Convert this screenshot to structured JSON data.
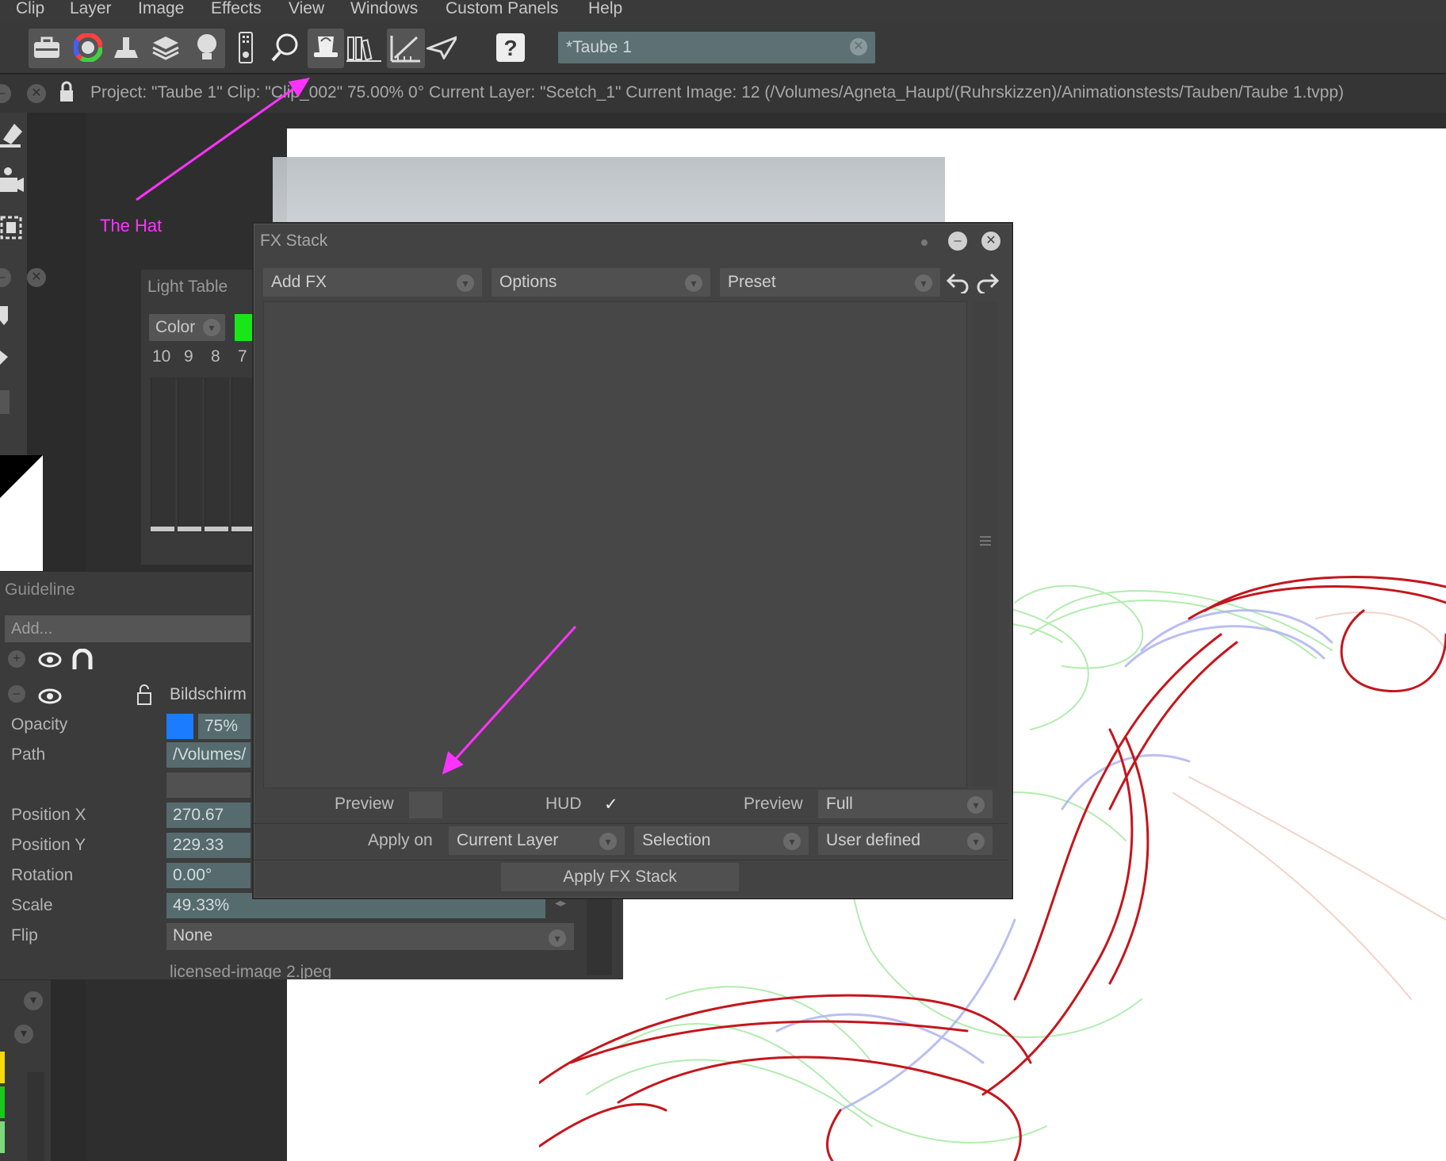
{
  "menu": [
    "Clip",
    "Layer",
    "Image",
    "Effects",
    "View",
    "Windows",
    "Custom Panels",
    "Help"
  ],
  "project_field": {
    "value": "*Taube 1"
  },
  "status": "Project:  \"Taube 1\"  Clip: \"Clip_002\"   75.00%   0°  Current Layer: \"Scetch_1\"  Current Image: 12 (/Volumes/Agneta_Haupt/(Ruhrskizzen)/Animationstests/Tauben/Taube 1.tvpp)",
  "annotation_hat": "The Hat",
  "light_table": {
    "title": "Light Table",
    "color_label": "Color",
    "numbers": [
      "10",
      "9",
      "8",
      "7"
    ]
  },
  "guideline": {
    "title": "Guideline",
    "add_label": "Add...",
    "item_name": "Bildschirm",
    "rows": {
      "opacity_label": "Opacity",
      "opacity_value": "75%",
      "path_label": "Path",
      "path_value": "/Volumes/",
      "posx_label": "Position X",
      "posx_value": "270.67",
      "posy_label": "Position Y",
      "posy_value": "229.33",
      "rotation_label": "Rotation",
      "rotation_value": "0.00°",
      "scale_label": "Scale",
      "scale_value": "49.33%",
      "flip_label": "Flip",
      "flip_value": "None"
    },
    "next_item": "licensed-image 2.jpeg"
  },
  "fx_stack": {
    "title": "FX Stack",
    "add_fx": "Add FX",
    "options": "Options",
    "preset": "Preset",
    "preview_label": "Preview",
    "hud_label": "HUD",
    "hud_check": "✓",
    "preview2_label": "Preview",
    "preview2_value": "Full",
    "apply_on_label": "Apply on",
    "apply_on_value": "Current Layer",
    "selection_value": "Selection",
    "range_value": "User defined",
    "apply_button": "Apply FX Stack"
  },
  "colors": {
    "annotation": "#ff33ff",
    "opacity_swatch": "#1a7cff",
    "light_green": "#19e619"
  }
}
